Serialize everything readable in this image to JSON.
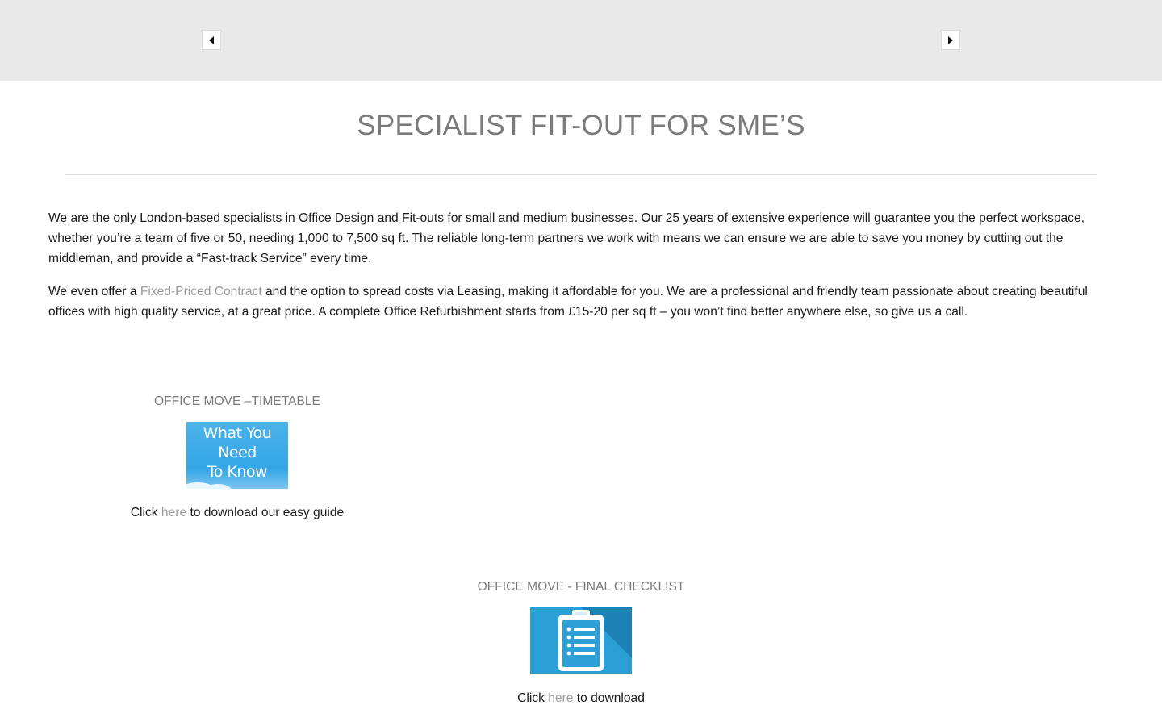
{
  "slider": {
    "prev_icon": "arrow-left-icon",
    "next_icon": "arrow-right-icon"
  },
  "title": "SPECIALIST FIT-OUT FOR SME’S",
  "intro": {
    "paragraph1": "We are the only London-based specialists in Office Design and Fit-outs for small and medium businesses. Our 25 years of extensive experience will guarantee you the perfect workspace, whether you’re a team of five or 50, needing 1,000 to 7,500 sq ft. The reliable long-term partners we work with means we can ensure we are able to save you money by cutting out the middleman, and provide a “Fast-track Service” every time.",
    "paragraph2_before": "We even offer a ",
    "paragraph2_link": "Fixed-Priced Contract",
    "paragraph2_after": " and the option to spread costs via Leasing, making it affordable for you. We are a professional and friendly team passionate about creating beautiful offices with high quality service, at a great price. A complete Office Refurbishment starts from £15-20 per sq ft – you won’t find better anywhere else, so give us a call."
  },
  "resources": [
    {
      "heading": "OFFICE MOVE –TIMETABLE",
      "image_text": [
        "What You",
        "Need",
        "To Know"
      ],
      "caption_before": "Click ",
      "caption_link": "here",
      "caption_after": " to download our easy guide"
    },
    {
      "heading": "OFFICE MOVE - FINAL CHECKLIST",
      "image_icon": "clipboard-icon",
      "caption_before": "Click ",
      "caption_link": "here",
      "caption_after": " to download"
    }
  ],
  "colors": {
    "slider_band": "#e9e9e9",
    "heading": "#7b7b7b",
    "link": "#9a9a9a",
    "sky_blue": "#35a6e6",
    "checklist_blue": "#2b9fd6"
  }
}
